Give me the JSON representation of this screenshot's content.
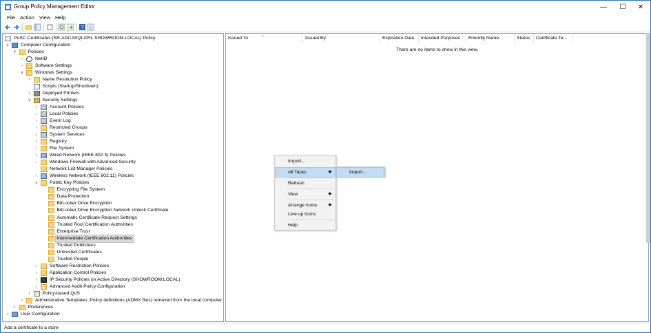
{
  "window": {
    "title": "Group Policy Management Editor",
    "controls": {
      "minimize": "—",
      "maximize": "☐",
      "close": "✕"
    }
  },
  "menu": [
    "File",
    "Action",
    "View",
    "Help"
  ],
  "tree": {
    "root": "PoSC Certificates [SR-ADCASQLCRL.SHOWROOM.LOCAL] Policy",
    "items": [
      "Computer Configuration",
      "Policies",
      "NetID",
      "Software Settings",
      "Windows Settings",
      "Name Resolution Policy",
      "Scripts (Startup/Shutdown)",
      "Deployed Printers",
      "Security Settings",
      "Account Policies",
      "Local Policies",
      "Event Log",
      "Restricted Groups",
      "System Services",
      "Registry",
      "File System",
      "Wired Network (IEEE 802.3) Policies",
      "Windows Firewall with Advanced Security",
      "Network List Manager Policies",
      "Wireless Network (IEEE 802.11) Policies",
      "Public Key Policies",
      "Encrypting File System",
      "Data Protection",
      "BitLocker Drive Encryption",
      "BitLocker Drive Encryption Network Unlock Certificate",
      "Automatic Certificate Request Settings",
      "Trusted Root Certification Authorities",
      "Enterprise Trust",
      "Intermediate Certification Authorities",
      "Trusted Publishers",
      "Untrusted Certificates",
      "Trusted People",
      "Software Restriction Policies",
      "Application Control Policies",
      "IP Security Policies on Active Directory (SHOWROOM.LOCAL)",
      "Advanced Audit Policy Configuration",
      "Policy-based QoS",
      "Administrative Templates: Policy definitions (ADMX files) retrieved from the local computer.",
      "Preferences",
      "User Configuration"
    ],
    "selected": "Intermediate Certification Authorities"
  },
  "list": {
    "columns": [
      "Issued To",
      "Issued By",
      "Expiration Date",
      "Intended Purposes",
      "Friendly Name",
      "Status",
      "Certificate Te..."
    ],
    "empty_message": "There are no items to show in this view."
  },
  "context_menu": {
    "items": [
      "Import...",
      "All Tasks",
      "Refresh",
      "View",
      "Arrange Icons",
      "Line up Icons",
      "Help"
    ],
    "submenu_item": "Import..."
  },
  "status": "Add a certificate to a store",
  "colors": {
    "selection": "#d9d9d9",
    "menu_highlight": "#c4dbf3",
    "folder": "#f4d47c"
  }
}
